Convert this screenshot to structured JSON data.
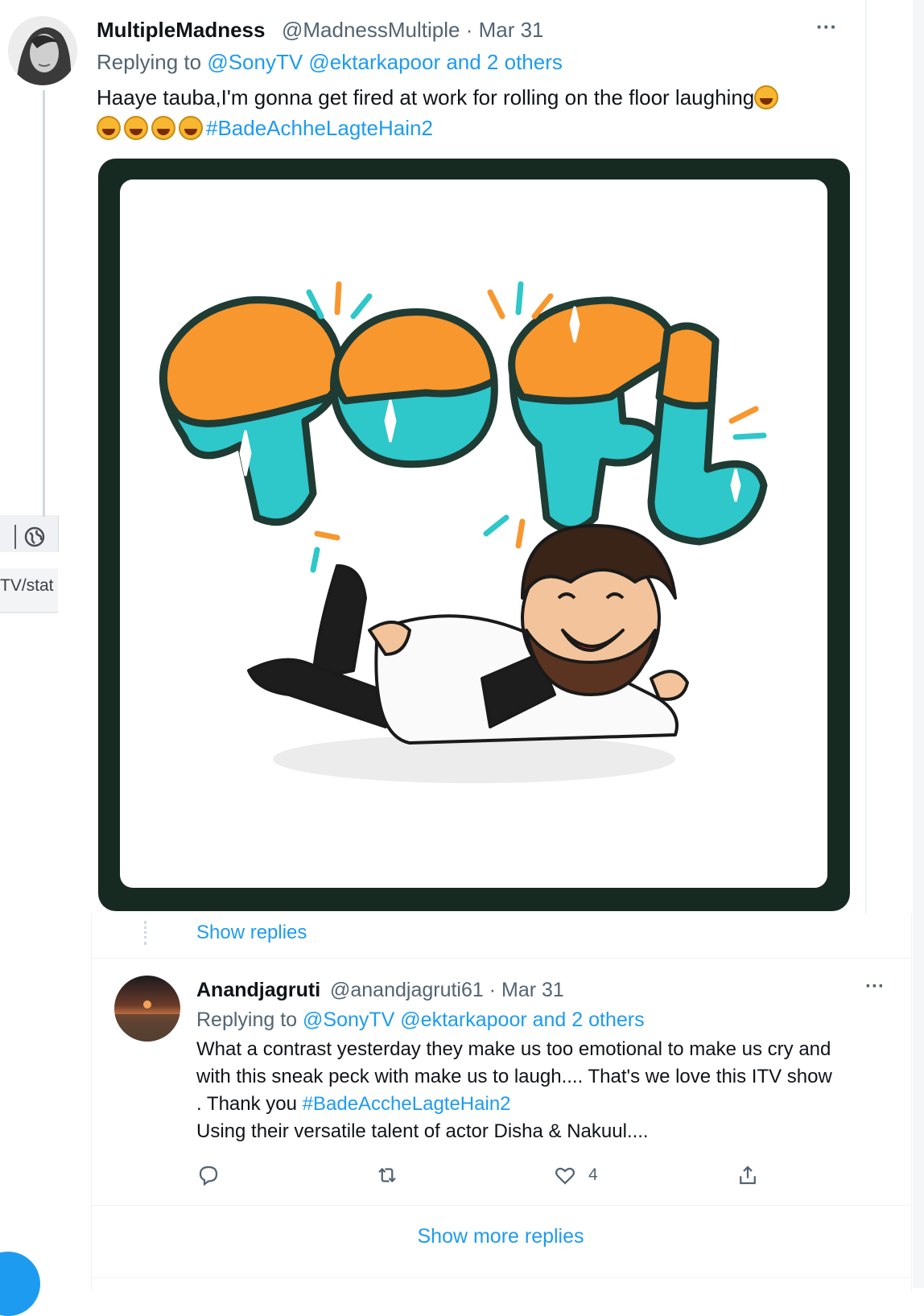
{
  "left_window": {
    "url_fragment": "TV/stat",
    "icon": "globe-icon"
  },
  "tweet1": {
    "display_name": "MultipleMadness",
    "handle_date": "@MadnessMultiple · Mar 31",
    "more_label": "···",
    "replying_prefix": "Replying to ",
    "replying_to": "@SonyTV @ektarkapoor and 2 others",
    "text_line1": "Haaye tauba,I'm gonna get fired at work for rolling on the floor laughing",
    "hashtag": "#BadeAchheLagteHain2",
    "emoji_icon": "rofl-emoji-icon",
    "media_icon": "rofl-sticker",
    "media_frame_color": "#172a22",
    "sticker_text": "ROFL",
    "sticker_orange": "#f7972e",
    "sticker_teal": "#2ec7ca"
  },
  "thread": {
    "show_replies": "Show replies"
  },
  "tweet2": {
    "display_name": "Anandjagruti",
    "handle_date": "@anandjagruti61 · Mar 31",
    "more_label": "···",
    "replying_prefix": "Replying to ",
    "replying_to": "@SonyTV @ektarkapoor and 2 others",
    "line1": "What a contrast yesterday they make us too emotional to make us cry and",
    "line2": "with this sneak peck with make us to laugh.... That's we love this ITV show",
    "line3_prefix": ". Thank you ",
    "line3_hashtag": "#BadeAccheLagteHain2",
    "line4": "Using their versatile talent of actor Disha & Nakuul....",
    "actions": {
      "reply_icon": "reply-icon",
      "retweet_icon": "retweet-icon",
      "like_icon": "heart-icon",
      "like_count": "4",
      "share_icon": "share-icon"
    }
  },
  "footer": {
    "show_more_replies": "Show more replies"
  },
  "colors": {
    "accent": "#1d9bf0",
    "secondary_text": "#536471"
  }
}
